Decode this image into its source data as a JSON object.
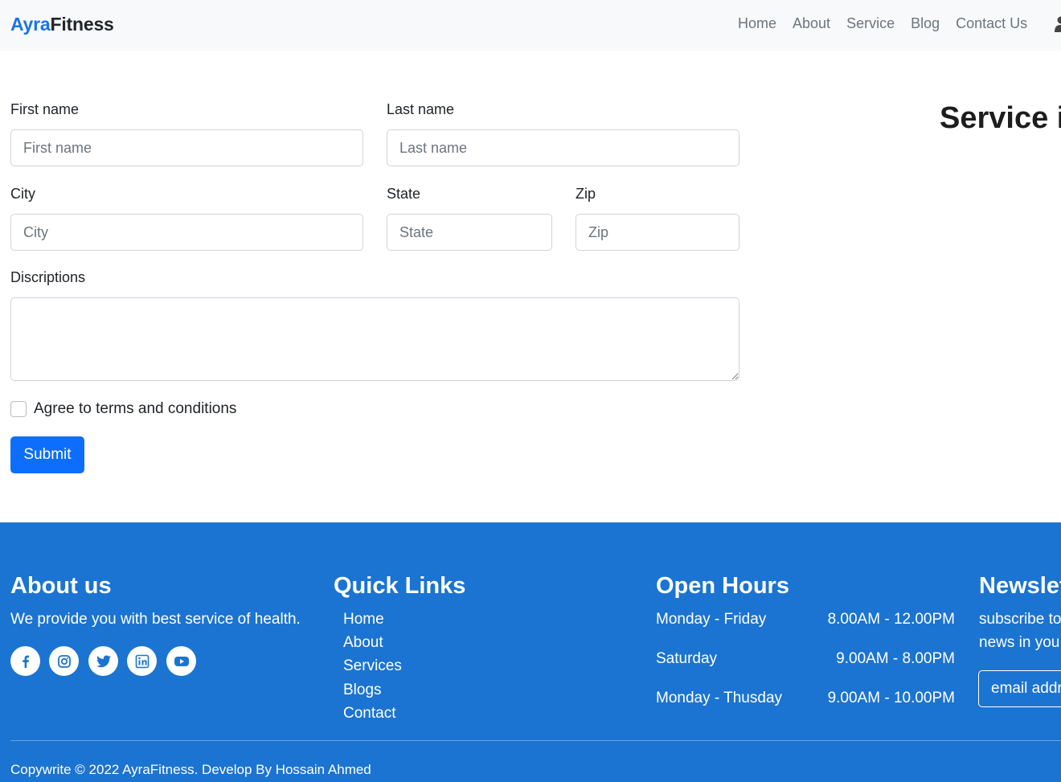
{
  "nav": {
    "brand_part1": "Ayra",
    "brand_part2": "Fitness",
    "links": [
      "Home",
      "About",
      "Service",
      "Blog",
      "Contact Us"
    ],
    "user_icon": "user-icon"
  },
  "form": {
    "first_name_label": "First name",
    "first_name_placeholder": "First name",
    "last_name_label": "Last name",
    "last_name_placeholder": "Last name",
    "city_label": "City",
    "city_placeholder": "City",
    "state_label": "State",
    "state_placeholder": "State",
    "zip_label": "Zip",
    "zip_placeholder": "Zip",
    "description_label": "Discriptions",
    "terms_label": "Agree to terms and conditions",
    "submit_label": "Submit"
  },
  "side": {
    "title": "Service id"
  },
  "footer": {
    "about_title": "About us",
    "about_text": "We provide you with best service of health.",
    "social_icons": [
      "facebook-icon",
      "instagram-icon",
      "twitter-icon",
      "linkedin-icon",
      "youtube-icon"
    ],
    "quick_title": "Quick Links",
    "quick_links": [
      "Home",
      "About",
      "Services",
      "Blogs",
      "Contact"
    ],
    "hours_title": "Open Hours",
    "hours": [
      {
        "day": "Monday - Friday",
        "time": "8.00AM - 12.00PM"
      },
      {
        "day": "Saturday",
        "time": "9.00AM - 8.00PM"
      },
      {
        "day": "Monday - Thusday",
        "time": "9.00AM - 10.00PM"
      }
    ],
    "newsletter_title": "Newsletter",
    "newsletter_line1": "subscribe to",
    "newsletter_line2": "news in you",
    "email_placeholder": "email address",
    "copyright": "Copywrite © 2022 AyraFitness. Develop By Hossain Ahmed"
  },
  "colors": {
    "primary": "#0d6efd",
    "footer_bg": "#1b74d1",
    "brand_accent": "#1a73e8",
    "navbar_bg": "#f8f9fa"
  }
}
